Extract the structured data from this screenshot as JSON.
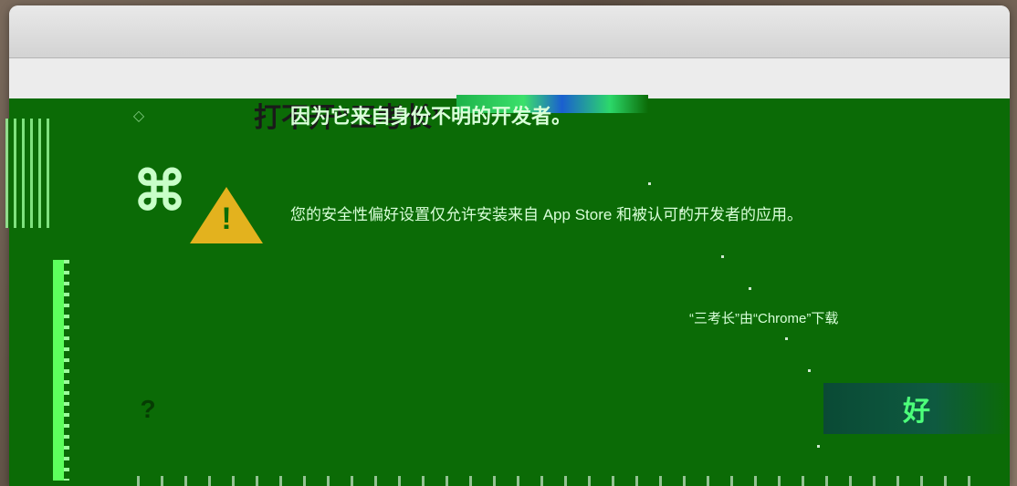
{
  "dialog": {
    "title": "打不开“三考长”",
    "title_continued": "因为它来自身份不明的开发者。",
    "message": "您的安全性偏好设置仅允许安装来自 App Store 和被认可的开发者的应用。",
    "hint": "“三考长”由“Chrome”下载",
    "ok_label": "好",
    "help_label": "?"
  },
  "icons": {
    "app_icon": "app-icon",
    "alert_icon": "warning-triangle-icon",
    "alert_mark": "!"
  },
  "colors": {
    "overlay": "#0b6b06",
    "titlebar": "#d8d8d8",
    "dialog_bg": "#ececec",
    "warning": "#e3b21e"
  }
}
